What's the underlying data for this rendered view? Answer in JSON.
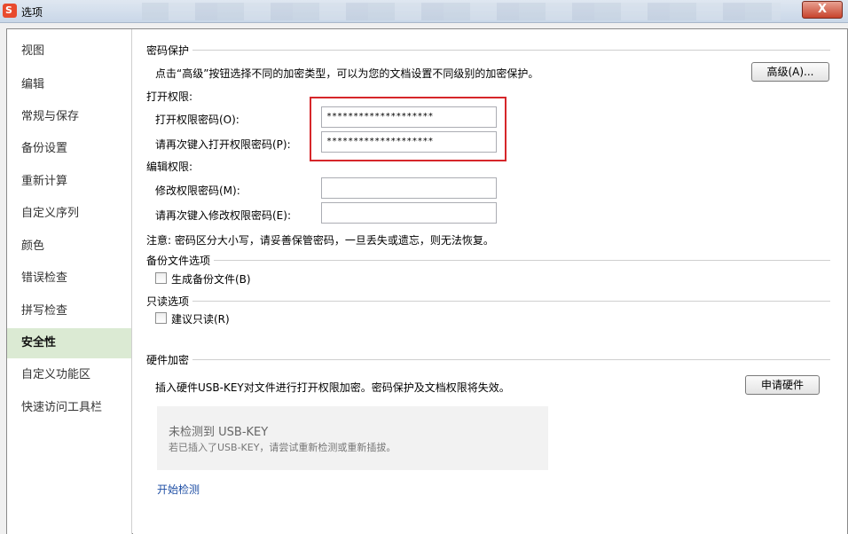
{
  "window": {
    "title": "选项",
    "app_icon_letter": "S",
    "close_label": "X"
  },
  "sidebar": {
    "items": [
      {
        "label": "视图"
      },
      {
        "label": "编辑"
      },
      {
        "label": "常规与保存"
      },
      {
        "label": "备份设置"
      },
      {
        "label": "重新计算"
      },
      {
        "label": "自定义序列"
      },
      {
        "label": "颜色"
      },
      {
        "label": "错误检查"
      },
      {
        "label": "拼写检查"
      },
      {
        "label": "安全性"
      },
      {
        "label": "自定义功能区"
      },
      {
        "label": "快速访问工具栏"
      }
    ],
    "active_index": 9
  },
  "password": {
    "section_title": "密码保护",
    "description": "点击“高级”按钮选择不同的加密类型，可以为您的文档设置不同级别的加密保护。",
    "advanced_button": "高级(A)...",
    "open_group_label": "打开权限:",
    "open_password_label": "打开权限密码(O):",
    "open_password_value": "********************",
    "open_confirm_label": "请再次键入打开权限密码(P):",
    "open_confirm_value": "********************",
    "edit_group_label": "编辑权限:",
    "edit_password_label": "修改权限密码(M):",
    "edit_password_value": "",
    "edit_confirm_label": "请再次键入修改权限密码(E):",
    "edit_confirm_value": "",
    "note": "注意: 密码区分大小写，请妥善保管密码，一旦丢失或遗忘，则无法恢复。"
  },
  "backup": {
    "section_title": "备份文件选项",
    "checkbox_label": "生成备份文件(B)",
    "checked": false
  },
  "readonly": {
    "section_title": "只读选项",
    "checkbox_label": "建议只读(R)",
    "checked": false
  },
  "hardware": {
    "section_title": "硬件加密",
    "description": "插入硬件USB-KEY对文件进行打开权限加密。密码保护及文档权限将失效。",
    "apply_button": "申请硬件",
    "status_title": "未检测到 USB-KEY",
    "status_hint": "若已插入了USB-KEY，请尝试重新检测或重新插拔。",
    "detect_link": "开始检测"
  },
  "colors": {
    "active_nav_bg": "#dbead3",
    "highlight_border": "#d6262a",
    "link": "#1f4fa5"
  }
}
